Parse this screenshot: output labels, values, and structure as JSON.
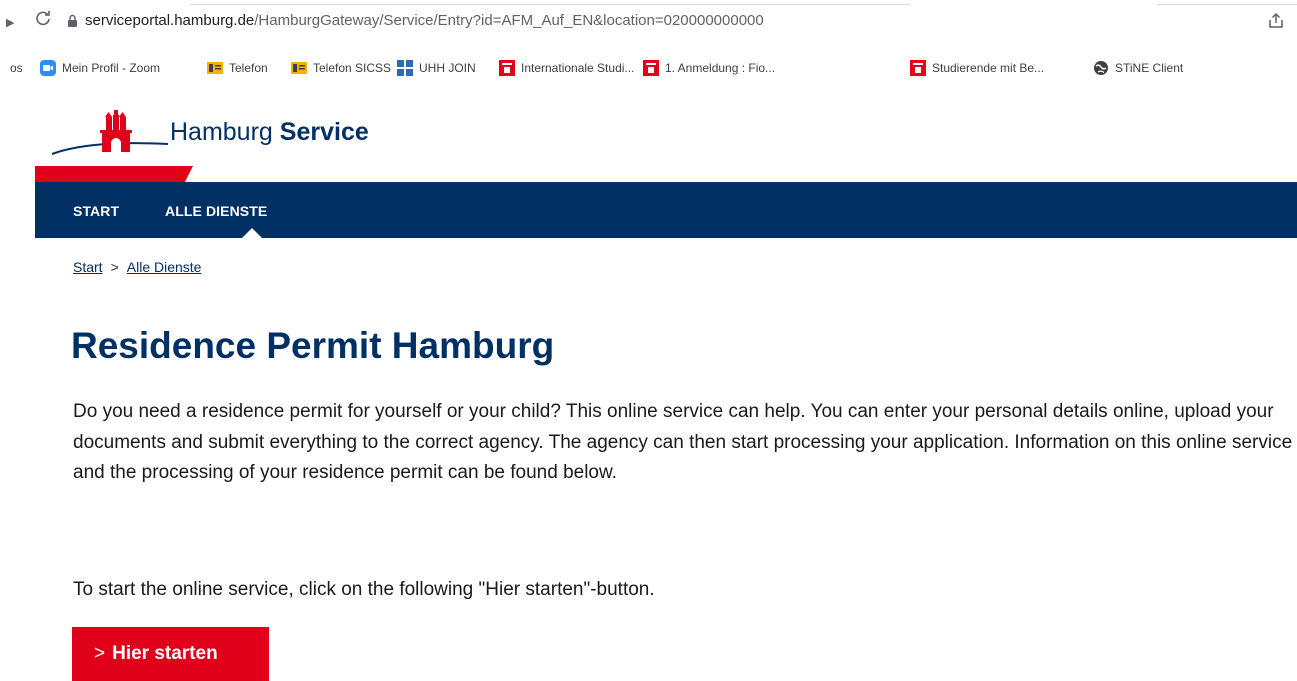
{
  "browser": {
    "url_host": "serviceportal.hamburg.de",
    "url_path": "/HamburgGateway/Service/Entry?id=AFM_Auf_EN&location=020000000000",
    "bookmarks_prefix": "os",
    "bookmarks": [
      {
        "label": "Mein Profil - Zoom",
        "icon": "zoom-icon",
        "color": "#2d8cff"
      },
      {
        "label": "Telefon",
        "icon": "phone-directory-icon",
        "color": "#f0b400"
      },
      {
        "label": "Telefon SICSS",
        "icon": "phone-directory-icon",
        "color": "#f0b400"
      },
      {
        "label": "UHH JOIN",
        "icon": "uhh-join-icon",
        "color": "#2b6cb0"
      },
      {
        "label": "Internationale Studi...",
        "icon": "uhh-logo-icon",
        "color": "#e2001a"
      },
      {
        "label": "1. Anmeldung : Fio...",
        "icon": "uhh-logo-icon",
        "color": "#e2001a"
      },
      {
        "label": "Studierende mit Be...",
        "icon": "uhh-logo-icon",
        "color": "#e2001a"
      },
      {
        "label": "STiNE Client",
        "icon": "globe-icon",
        "color": "#3c4043"
      }
    ]
  },
  "site": {
    "logo_text_regular": "Hamburg",
    "logo_text_bold": "Service",
    "nav": [
      {
        "label": "START"
      },
      {
        "label": "ALLE DIENSTE",
        "active": true
      }
    ],
    "colors": {
      "brand_blue": "#003064",
      "brand_red": "#e10019"
    }
  },
  "breadcrumb": {
    "items": [
      "Start",
      "Alle Dienste"
    ],
    "separator": ">"
  },
  "content": {
    "title": "Residence Permit Hamburg",
    "intro": "Do you need a residence permit for yourself or your child? This online service can help. You can enter your personal details online, upload your documents and submit everything to the correct agency. The agency can then start processing your application. Information on this online service and the processing of your residence permit can be found below.",
    "instruction": "To start the online service, click on the following \"Hier starten\"-button.",
    "start_button": {
      "chevron": ">",
      "label": "Hier starten"
    }
  }
}
